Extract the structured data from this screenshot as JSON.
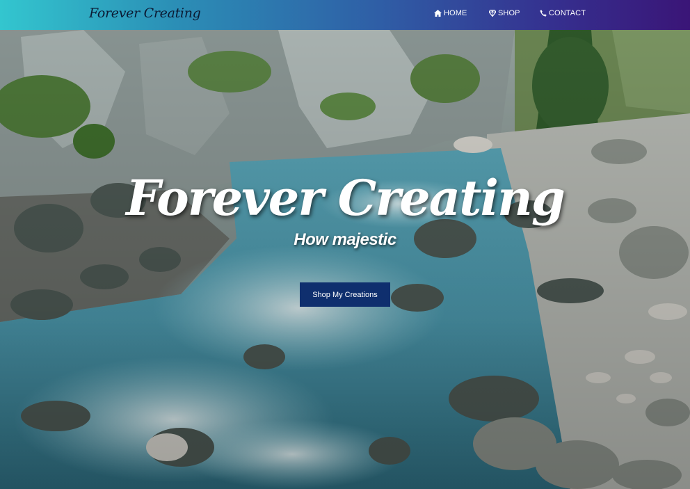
{
  "brand": {
    "name": "Forever Creating"
  },
  "nav": {
    "items": [
      {
        "label": "HOME",
        "icon": "home-icon"
      },
      {
        "label": "SHOP",
        "icon": "diamond-icon"
      },
      {
        "label": "CONTACT",
        "icon": "phone-icon"
      }
    ]
  },
  "hero": {
    "title": "Forever Creating",
    "subtitle": "How majestic",
    "cta_label": "Shop My Creations"
  },
  "colors": {
    "nav_gradient_start": "#33c6cf",
    "nav_gradient_end": "#3a1577",
    "cta_background": "#0f2f6e",
    "brand_text": "#0b1a33"
  }
}
